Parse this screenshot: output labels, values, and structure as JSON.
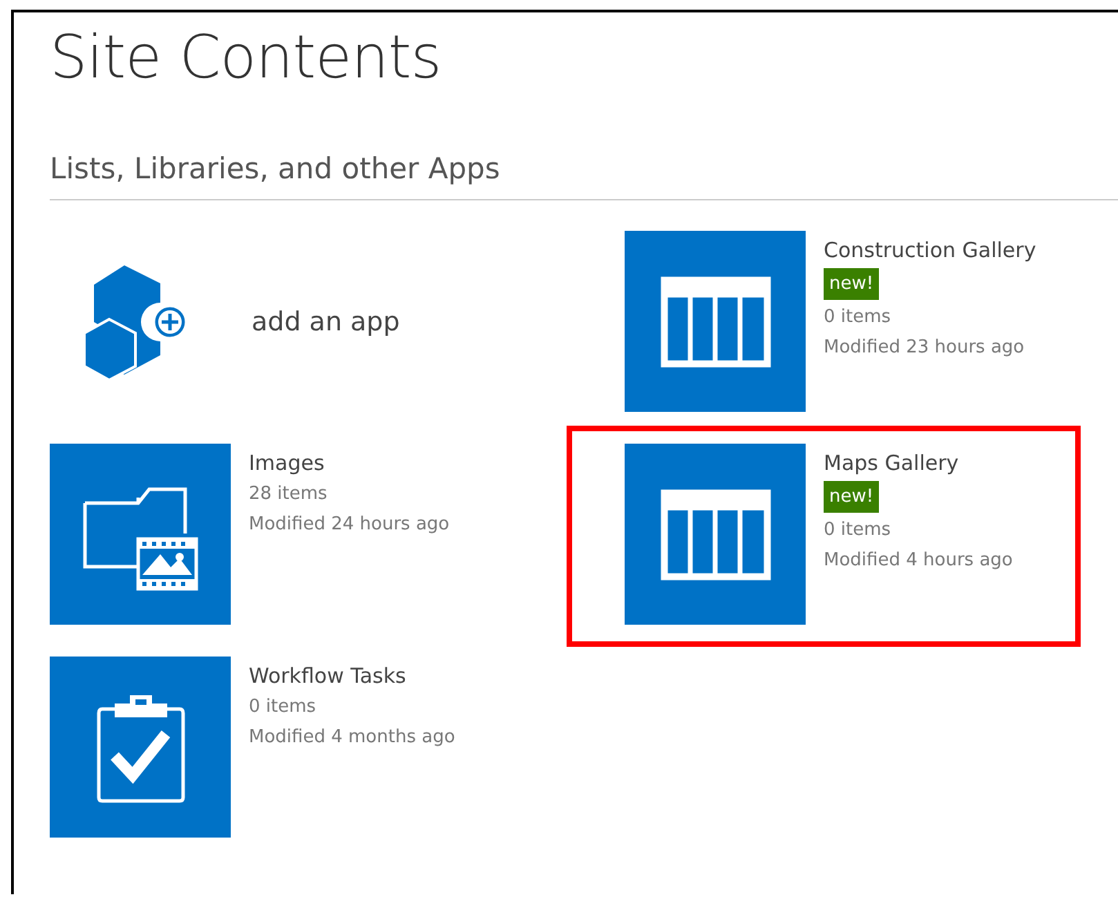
{
  "page": {
    "title": "Site Contents",
    "section_title": "Lists, Libraries, and other Apps"
  },
  "apps": [
    {
      "kind": "add",
      "title": "add an app"
    },
    {
      "kind": "images",
      "title": "Images",
      "count": "28 items",
      "modified": "Modified 24 hours ago",
      "highlighted": false
    },
    {
      "kind": "tasks",
      "title": "Workflow Tasks",
      "count": "0 items",
      "modified": "Modified 4 months ago",
      "highlighted": false
    },
    {
      "kind": "gallery",
      "title": "Construction Gallery",
      "badge": "new!",
      "count": "0 items",
      "modified": "Modified 23 hours ago",
      "highlighted": false
    },
    {
      "kind": "gallery",
      "title": "Maps Gallery",
      "badge": "new!",
      "count": "0 items",
      "modified": "Modified 4 hours ago",
      "highlighted": true
    }
  ]
}
